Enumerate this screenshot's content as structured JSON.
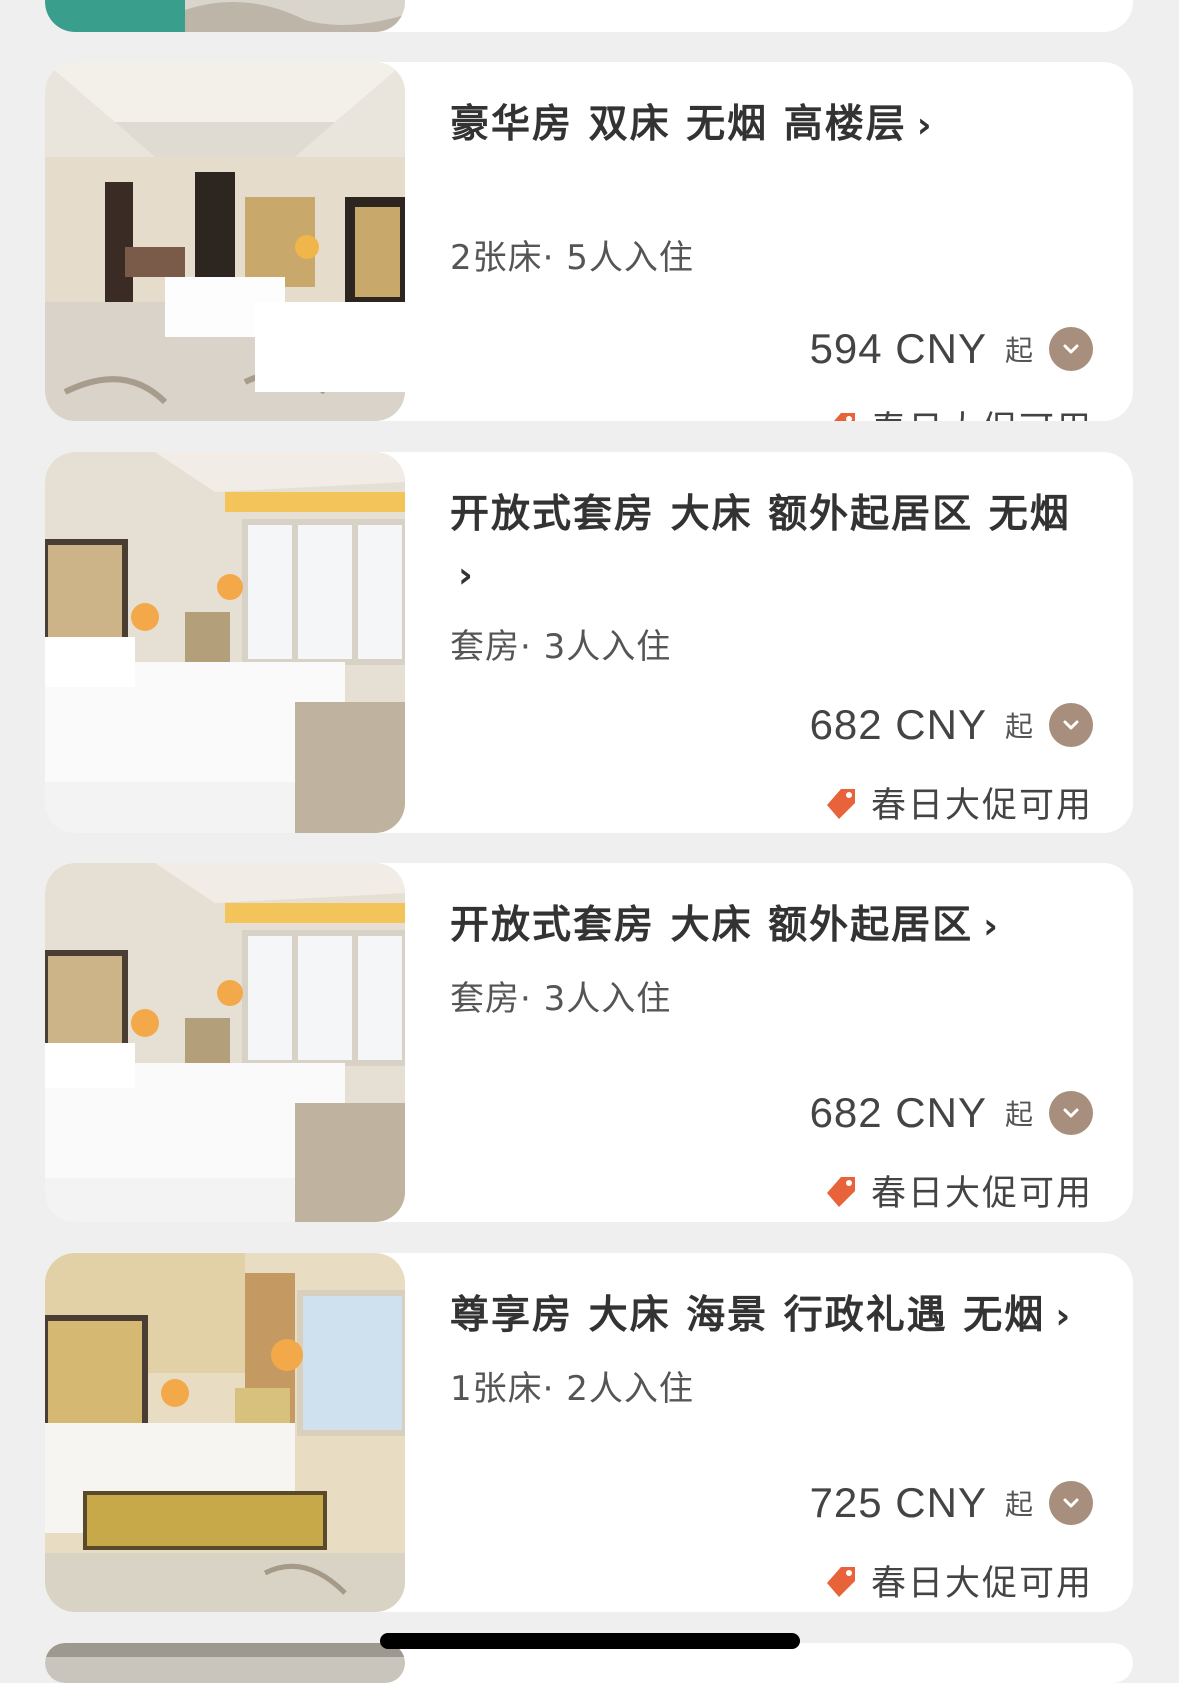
{
  "colors": {
    "background": "#efefef",
    "card": "#ffffff",
    "expand_button": "#a88e7c",
    "promo_tag": "#e8623a",
    "title_text": "#333333"
  },
  "rooms": [
    {
      "title": "豪华房 双床 无烟 高楼层",
      "meta": "2张床· 5人入住",
      "price": "594 CNY",
      "price_suffix": "起",
      "promo": "春日大促可用"
    },
    {
      "title": "开放式套房 大床 额外起居区 无烟",
      "meta": "套房· 3人入住",
      "price": "682 CNY",
      "price_suffix": "起",
      "promo": "春日大促可用"
    },
    {
      "title": "开放式套房 大床 额外起居区",
      "meta": "套房· 3人入住",
      "price": "682 CNY",
      "price_suffix": "起",
      "promo": "春日大促可用"
    },
    {
      "title": "尊享房 大床 海景 行政礼遇 无烟",
      "meta": "1张床· 2人入住",
      "price": "725 CNY",
      "price_suffix": "起",
      "promo": "春日大促可用"
    }
  ],
  "icons": {
    "title_chevron": "chevron-right-icon",
    "expand": "chevron-down-circle-icon",
    "promo": "price-tag-icon"
  }
}
